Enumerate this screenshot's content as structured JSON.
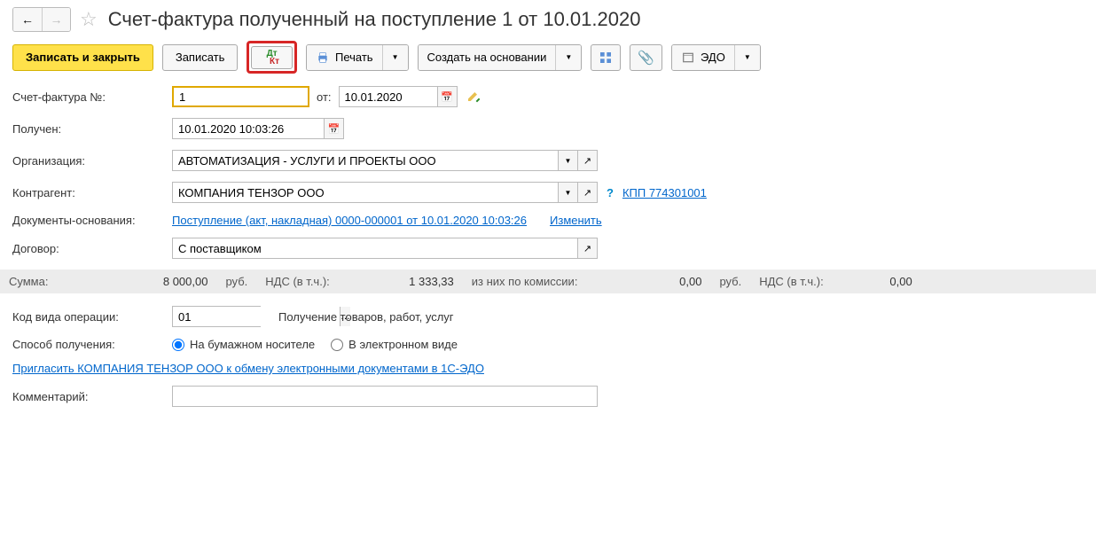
{
  "title": "Счет-фактура полученный на поступление 1 от 10.01.2020",
  "toolbar": {
    "save_close": "Записать и закрыть",
    "save": "Записать",
    "print": "Печать",
    "create_based": "Создать на основании",
    "edo": "ЭДО"
  },
  "form": {
    "number_label": "Счет-фактура №:",
    "number": "1",
    "from_label": "от:",
    "from_date": "10.01.2020",
    "received_label": "Получен:",
    "received": "10.01.2020 10:03:26",
    "org_label": "Организация:",
    "org": "АВТОМАТИЗАЦИЯ - УСЛУГИ И ПРОЕКТЫ ООО",
    "contractor_label": "Контрагент:",
    "contractor": "КОМПАНИЯ ТЕНЗОР ООО",
    "kpp": "КПП 774301001",
    "basis_label": "Документы-основания:",
    "basis_link": "Поступление (акт, накладная) 0000-000001 от 10.01.2020 10:03:26",
    "change": "Изменить",
    "contract_label": "Договор:",
    "contract": "С поставщиком",
    "op_code_label": "Код вида операции:",
    "op_code": "01",
    "op_code_desc": "Получение товаров, работ, услуг",
    "method_label": "Способ получения:",
    "method_paper": "На бумажном носителе",
    "method_electronic": "В электронном виде",
    "invite_link": "Пригласить КОМПАНИЯ ТЕНЗОР ООО к обмену электронными документами в 1С-ЭДО",
    "comment_label": "Комментарий:"
  },
  "summary": {
    "sum_label": "Сумма:",
    "sum": "8 000,00",
    "rub": "руб.",
    "vat_label": "НДС (в т.ч.):",
    "vat": "1 333,33",
    "commission_label": "из них по комиссии:",
    "commission": "0,00",
    "rub2": "руб.",
    "vat_label2": "НДС (в т.ч.):",
    "vat2": "0,00"
  }
}
